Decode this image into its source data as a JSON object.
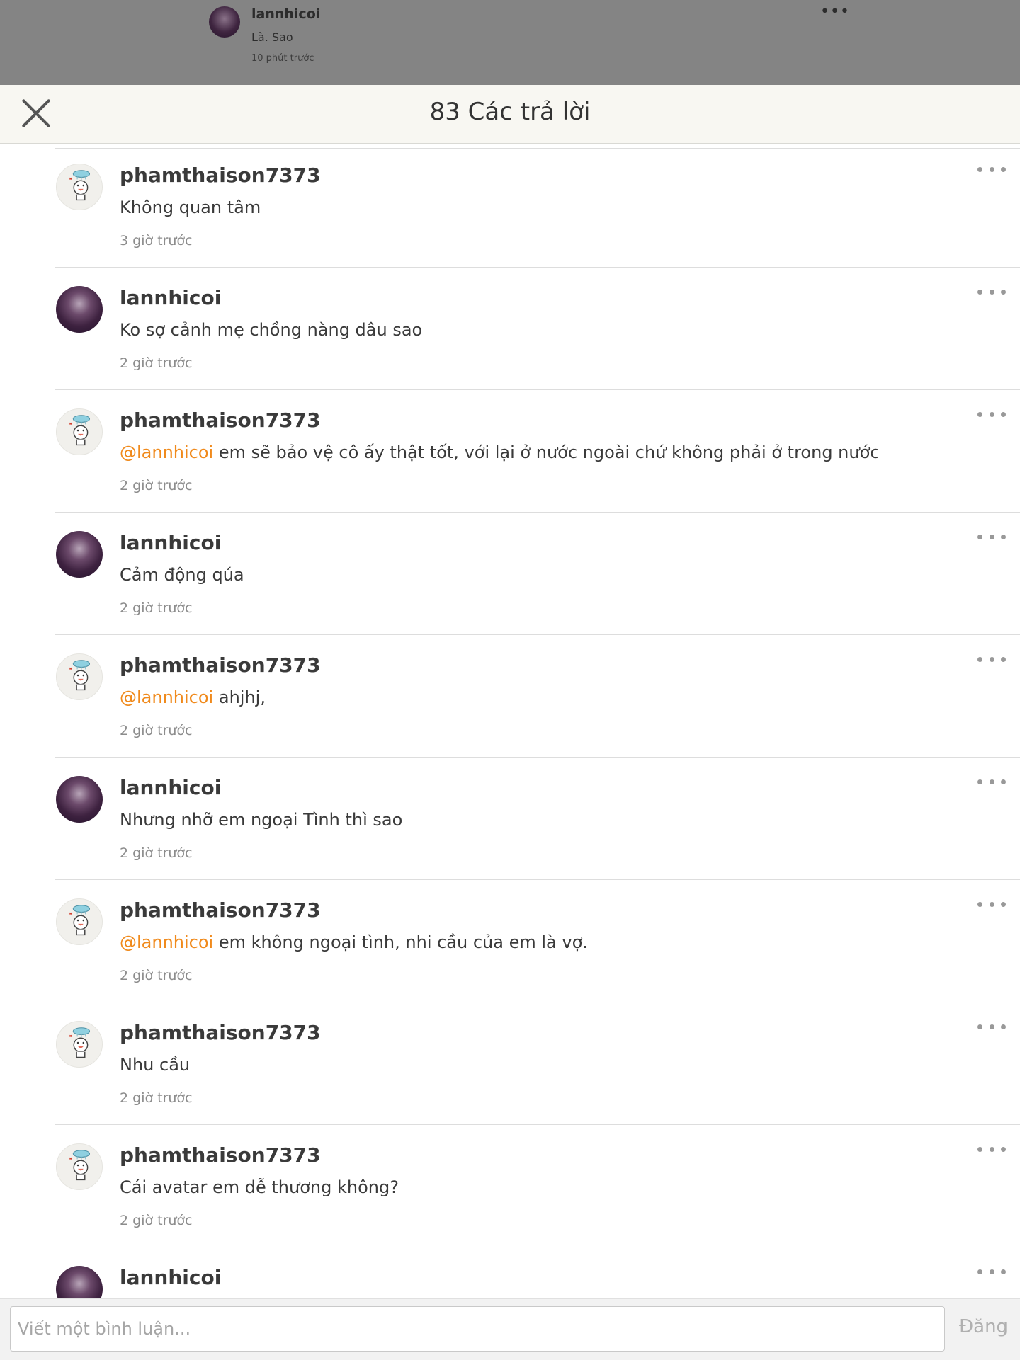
{
  "background_post": {
    "username": "lannhicoi",
    "text": "Là. Sao",
    "time": "10 phút trước"
  },
  "header": {
    "title": "83 Các trả lời"
  },
  "comments": [
    {
      "username": "phamthaison7373",
      "avatar": "cartoon-avatar",
      "mention": "",
      "text": "Không quan tâm",
      "time": "3 giờ trước"
    },
    {
      "username": "lannhicoi",
      "avatar": "photo-avatar",
      "mention": "",
      "text": "Ko sợ cảnh mẹ chồng nàng dâu sao",
      "time": "2 giờ trước"
    },
    {
      "username": "phamthaison7373",
      "avatar": "cartoon-avatar",
      "mention": "@lannhicoi",
      "text": " em sẽ bảo vệ cô ấy thật tốt, với lại ở nước ngoài chứ không phải ở trong nước",
      "time": "2 giờ trước"
    },
    {
      "username": "lannhicoi",
      "avatar": "photo-avatar",
      "mention": "",
      "text": "Cảm động qúa",
      "time": "2 giờ trước"
    },
    {
      "username": "phamthaison7373",
      "avatar": "cartoon-avatar",
      "mention": "@lannhicoi",
      "text": " ahjhj,",
      "time": "2 giờ trước"
    },
    {
      "username": "lannhicoi",
      "avatar": "photo-avatar",
      "mention": "",
      "text": "Nhưng nhỡ em ngoại Tình thì sao",
      "time": "2 giờ trước"
    },
    {
      "username": "phamthaison7373",
      "avatar": "cartoon-avatar",
      "mention": "@lannhicoi",
      "text": " em không ngoại tình, nhi cầu của em là vợ.",
      "time": "2 giờ trước"
    },
    {
      "username": "phamthaison7373",
      "avatar": "cartoon-avatar",
      "mention": "",
      "text": "Nhu cầu",
      "time": "2 giờ trước"
    },
    {
      "username": "phamthaison7373",
      "avatar": "cartoon-avatar",
      "mention": "",
      "text": "Cái avatar em dễ thương không?",
      "time": "2 giờ trước"
    },
    {
      "username": "lannhicoi",
      "avatar": "photo-avatar",
      "mention": "",
      "text": "",
      "time": ""
    }
  ],
  "composer": {
    "placeholder": "Viết một bình luận...",
    "post_label": "Đăng"
  },
  "colors": {
    "mention": "#f08a1c",
    "header_bg": "#f8f7f2",
    "overlay_bg": "#848484"
  }
}
